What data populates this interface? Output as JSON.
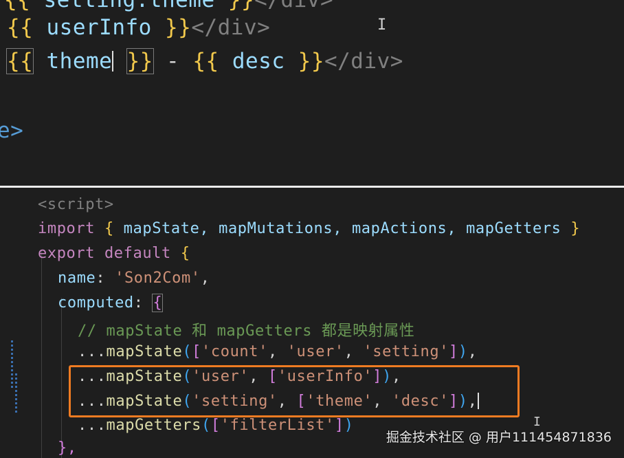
{
  "top_code": {
    "line0": {
      "prefix": "{{ ",
      "expr": "setting.theme",
      "suffix": " }}",
      "close_tag": "</div>"
    },
    "line1": {
      "open": "{{",
      "expr": "userInfo",
      "close": "}}",
      "close_tag": "</div>"
    },
    "line2": {
      "open": "{{",
      "expr1": "theme",
      "close1": "}}",
      "sep": " - ",
      "open2": "{{",
      "expr2": "desc",
      "close2": "}}",
      "close_tag": "</div>"
    },
    "line3": {
      "text": "e>"
    }
  },
  "bottom_code": {
    "l1": "<script>",
    "l2": {
      "kw": "import",
      "names": "mapState, mapMutations, mapActions, mapGetters",
      "open": "{",
      "close": "}"
    },
    "l3": {
      "kw1": "export",
      "kw2": "default",
      "brace": "{"
    },
    "l4": {
      "prop": "name",
      "str": "'Son2Com'"
    },
    "l5": {
      "prop": "computed",
      "brace": "{"
    },
    "l6": {
      "comment": "// mapState 和 mapGetters 都是映射属性"
    },
    "l7": {
      "spread": "...",
      "fn": "mapState",
      "args": [
        "'count'",
        "'user'",
        "'setting'"
      ]
    },
    "l8": {
      "spread": "...",
      "fn": "mapState",
      "ns": "'user'",
      "args": [
        "'userInfo'"
      ]
    },
    "l9": {
      "spread": "...",
      "fn": "mapState",
      "ns": "'setting'",
      "args": [
        "'theme'",
        "'desc'"
      ]
    },
    "l10": {
      "spread": "...",
      "fn": "mapGetters",
      "args": [
        "'filterList'"
      ]
    },
    "l11": {
      "text": "},"
    }
  },
  "watermark": "掘金技术社区 @ 用户111454871836",
  "colors": {
    "highlight": "#ef7b22",
    "brace_yellow": "#f2c94c",
    "brace_purple": "#d27ddc"
  }
}
